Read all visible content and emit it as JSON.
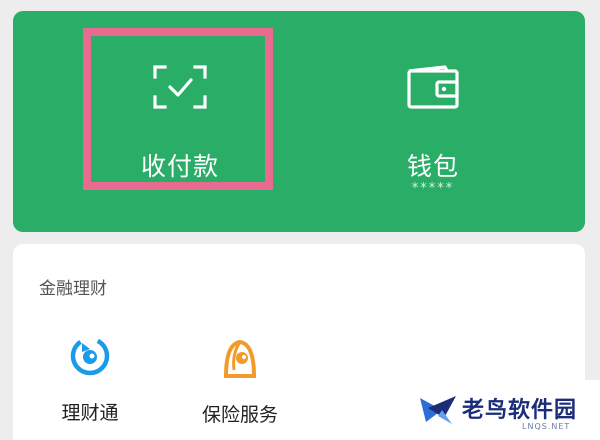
{
  "top_panel": {
    "pay": {
      "label": "收付款",
      "icon": "scan-check-icon"
    },
    "wallet": {
      "label": "钱包",
      "balance_mask": "*****",
      "icon": "wallet-icon"
    }
  },
  "finance": {
    "title": "金融理财",
    "items": [
      {
        "label": "理财通",
        "icon": "licaitong-icon"
      },
      {
        "label": "保险服务",
        "icon": "insurance-icon"
      }
    ]
  },
  "watermark": {
    "text": "老鸟软件园",
    "sub": "LNQS.NET"
  },
  "colors": {
    "panel_green": "#2aae67",
    "highlight": "#e86b8f",
    "licaitong_blue": "#1a9be8",
    "insurance_orange": "#f29b2c"
  }
}
